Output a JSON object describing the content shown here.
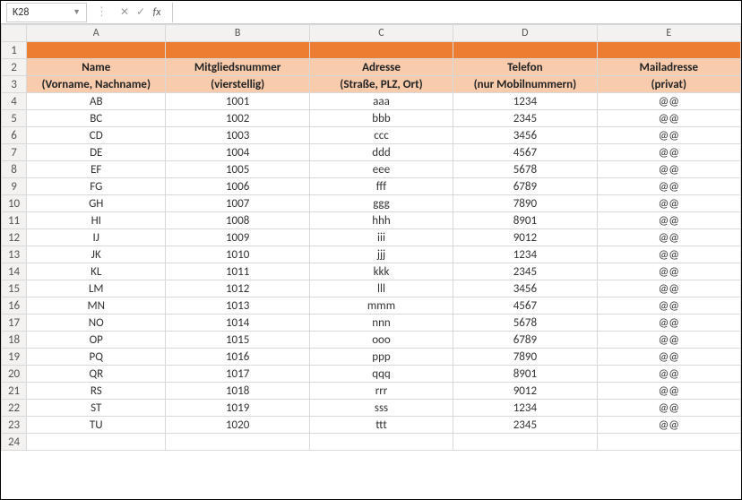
{
  "formulaBar": {
    "cellRef": "K28",
    "fxLabel": "fx",
    "value": ""
  },
  "columns": [
    "A",
    "B",
    "C",
    "D",
    "E"
  ],
  "headers": {
    "name1": "Name",
    "name2": "(Vorname, Nachname)",
    "memno1": "Mitgliedsnummer",
    "memno2": "(vierstellig)",
    "addr1": "Adresse",
    "addr2": "(Straße, PLZ, Ort)",
    "tel1": "Telefon",
    "tel2": "(nur Mobilnummern)",
    "mail1": "Mailadresse",
    "mail2": "(privat)"
  },
  "rows": [
    {
      "n": "4",
      "a": "AB",
      "b": "1001",
      "c": "aaa",
      "d": "1234",
      "e": "@@"
    },
    {
      "n": "5",
      "a": "BC",
      "b": "1002",
      "c": "bbb",
      "d": "2345",
      "e": "@@"
    },
    {
      "n": "6",
      "a": "CD",
      "b": "1003",
      "c": "ccc",
      "d": "3456",
      "e": "@@"
    },
    {
      "n": "7",
      "a": "DE",
      "b": "1004",
      "c": "ddd",
      "d": "4567",
      "e": "@@"
    },
    {
      "n": "8",
      "a": "EF",
      "b": "1005",
      "c": "eee",
      "d": "5678",
      "e": "@@"
    },
    {
      "n": "9",
      "a": "FG",
      "b": "1006",
      "c": "fff",
      "d": "6789",
      "e": "@@"
    },
    {
      "n": "10",
      "a": "GH",
      "b": "1007",
      "c": "ggg",
      "d": "7890",
      "e": "@@"
    },
    {
      "n": "11",
      "a": "HI",
      "b": "1008",
      "c": "hhh",
      "d": "8901",
      "e": "@@"
    },
    {
      "n": "12",
      "a": "IJ",
      "b": "1009",
      "c": "iii",
      "d": "9012",
      "e": "@@"
    },
    {
      "n": "13",
      "a": "JK",
      "b": "1010",
      "c": "jjj",
      "d": "1234",
      "e": "@@"
    },
    {
      "n": "14",
      "a": "KL",
      "b": "1011",
      "c": "kkk",
      "d": "2345",
      "e": "@@"
    },
    {
      "n": "15",
      "a": "LM",
      "b": "1012",
      "c": "lll",
      "d": "3456",
      "e": "@@"
    },
    {
      "n": "16",
      "a": "MN",
      "b": "1013",
      "c": "mmm",
      "d": "4567",
      "e": "@@"
    },
    {
      "n": "17",
      "a": "NO",
      "b": "1014",
      "c": "nnn",
      "d": "5678",
      "e": "@@"
    },
    {
      "n": "18",
      "a": "OP",
      "b": "1015",
      "c": "ooo",
      "d": "6789",
      "e": "@@"
    },
    {
      "n": "19",
      "a": "PQ",
      "b": "1016",
      "c": "ppp",
      "d": "7890",
      "e": "@@"
    },
    {
      "n": "20",
      "a": "QR",
      "b": "1017",
      "c": "qqq",
      "d": "8901",
      "e": "@@"
    },
    {
      "n": "21",
      "a": "RS",
      "b": "1018",
      "c": "rrr",
      "d": "9012",
      "e": "@@"
    },
    {
      "n": "22",
      "a": "ST",
      "b": "1019",
      "c": "sss",
      "d": "1234",
      "e": "@@"
    },
    {
      "n": "23",
      "a": "TU",
      "b": "1020",
      "c": "ttt",
      "d": "2345",
      "e": "@@"
    }
  ],
  "extraRow": "24"
}
